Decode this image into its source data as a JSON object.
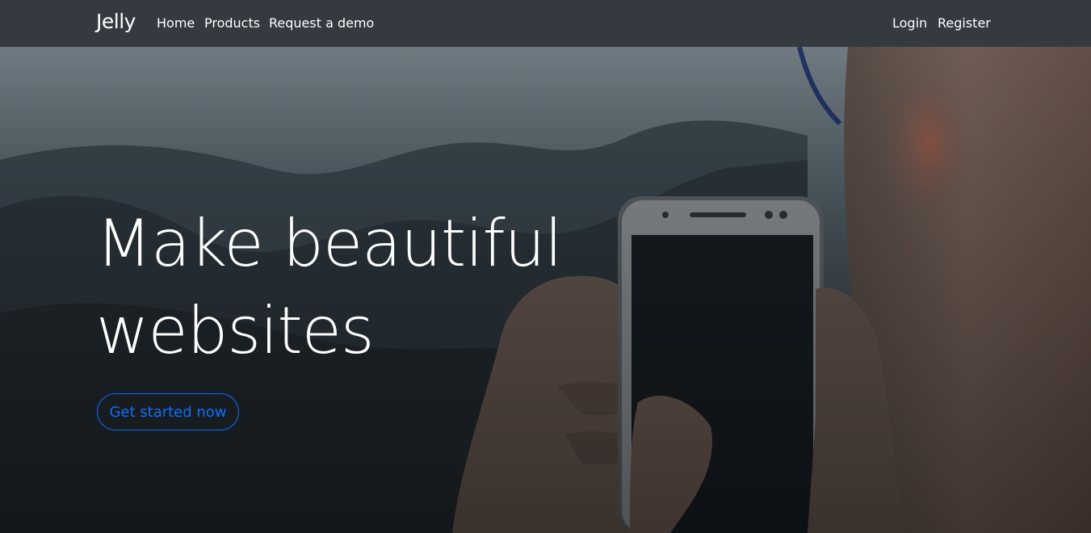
{
  "navbar": {
    "brand": "Jelly",
    "left_links": [
      {
        "label": "Home"
      },
      {
        "label": "Products"
      },
      {
        "label": "Request a demo"
      }
    ],
    "right_links": [
      {
        "label": "Login"
      },
      {
        "label": "Register"
      }
    ]
  },
  "hero": {
    "headline_line1": "Make beautiful",
    "headline_line2": "websites",
    "cta_label": "Get started now"
  },
  "colors": {
    "navbar_bg": "#343a40",
    "text": "#ffffff",
    "accent": "#0d6efd"
  }
}
